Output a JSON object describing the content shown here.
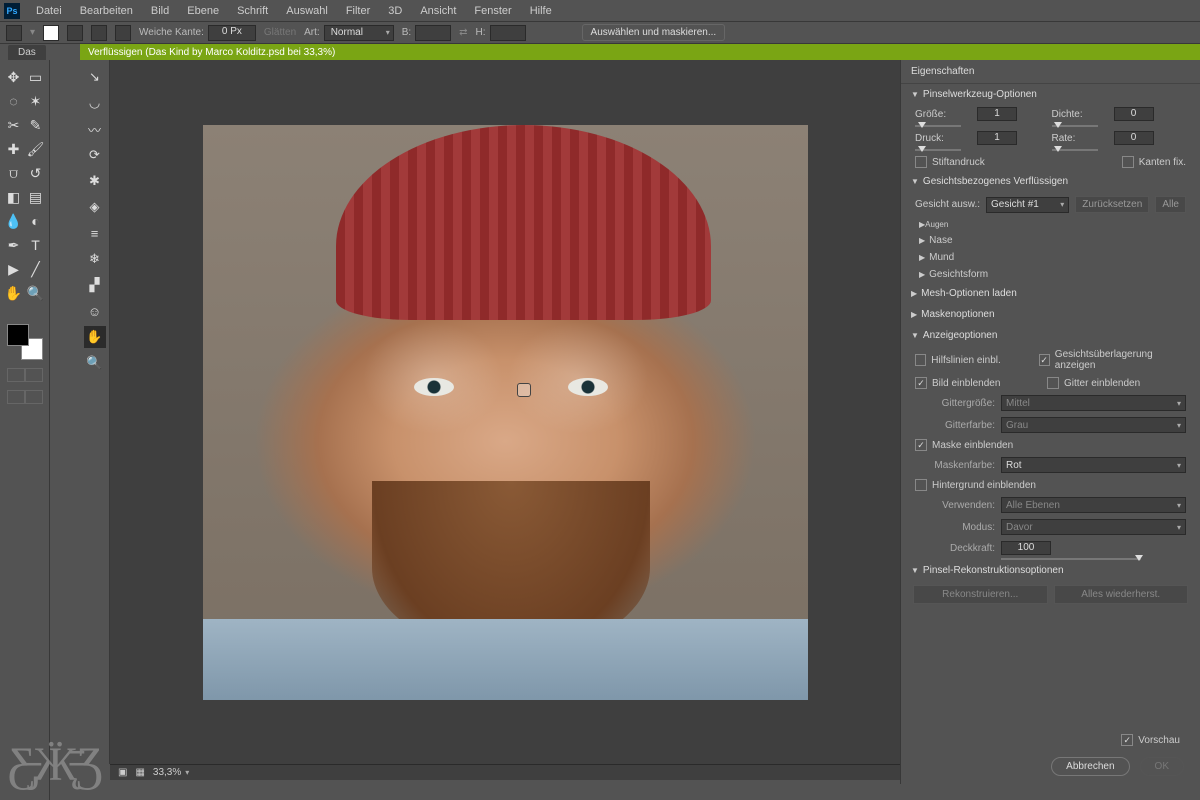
{
  "menu": [
    "Datei",
    "Bearbeiten",
    "Bild",
    "Ebene",
    "Schrift",
    "Auswahl",
    "Filter",
    "3D",
    "Ansicht",
    "Fenster",
    "Hilfe"
  ],
  "options": {
    "weiche_kante": "Weiche Kante:",
    "weiche_kante_val": "0 Px",
    "glatt": "Glätten",
    "art": "Art:",
    "art_val": "Normal",
    "b_lbl": "B:",
    "h_lbl": "H:",
    "sel_mask": "Auswählen und maskieren..."
  },
  "doc_tab": "Das",
  "green_bar": "Verflüssigen (Das Kind by Marco Kolditz.psd bei 33,3%)",
  "status_zoom": "33,3%",
  "props": {
    "title": "Eigenschaften",
    "sec_brush": "Pinselwerkzeug-Optionen",
    "groesse": "Größe:",
    "druck": "Druck:",
    "dichte": "Dichte:",
    "rate": "Rate:",
    "v1": "1",
    "v2": "1",
    "v3": "0",
    "v4": "0",
    "stiftandruck": "Stiftandruck",
    "kanten": "Kanten fix.",
    "sec_face": "Gesichtsbezogenes Verflüssigen",
    "face_sel_lbl": "Gesicht ausw.:",
    "face_sel": "Gesicht #1",
    "reset": "Zurücksetzen",
    "alle": "Alle",
    "augen": "Augen",
    "nase": "Nase",
    "mund": "Mund",
    "form": "Gesichtsform",
    "sec_mesh": "Mesh-Optionen laden",
    "sec_mask": "Maskenoptionen",
    "sec_view": "Anzeigeoptionen",
    "hilfs": "Hilfslinien einbl.",
    "ueberlag": "Gesichtsüberlagerung anzeigen",
    "bild": "Bild einblenden",
    "gitter": "Gitter einblenden",
    "gittergr_lbl": "Gittergröße:",
    "gittergr": "Mittel",
    "gitterf_lbl": "Gitterfarbe:",
    "gitterf": "Grau",
    "maske": "Maske einblenden",
    "maskenf_lbl": "Maskenfarbe:",
    "maskenf": "Rot",
    "hinter": "Hintergrund einblenden",
    "verw_lbl": "Verwenden:",
    "verw": "Alle Ebenen",
    "modus_lbl": "Modus:",
    "modus": "Davor",
    "deck_lbl": "Deckkraft:",
    "deck": "100",
    "sec_recon": "Pinsel-Rekonstruktionsoptionen",
    "rekon": "Rekonstruieren...",
    "wieder": "Alles wiederherst.",
    "vorschau": "Vorschau",
    "abbrechen": "Abbrechen",
    "ok": "OK"
  }
}
